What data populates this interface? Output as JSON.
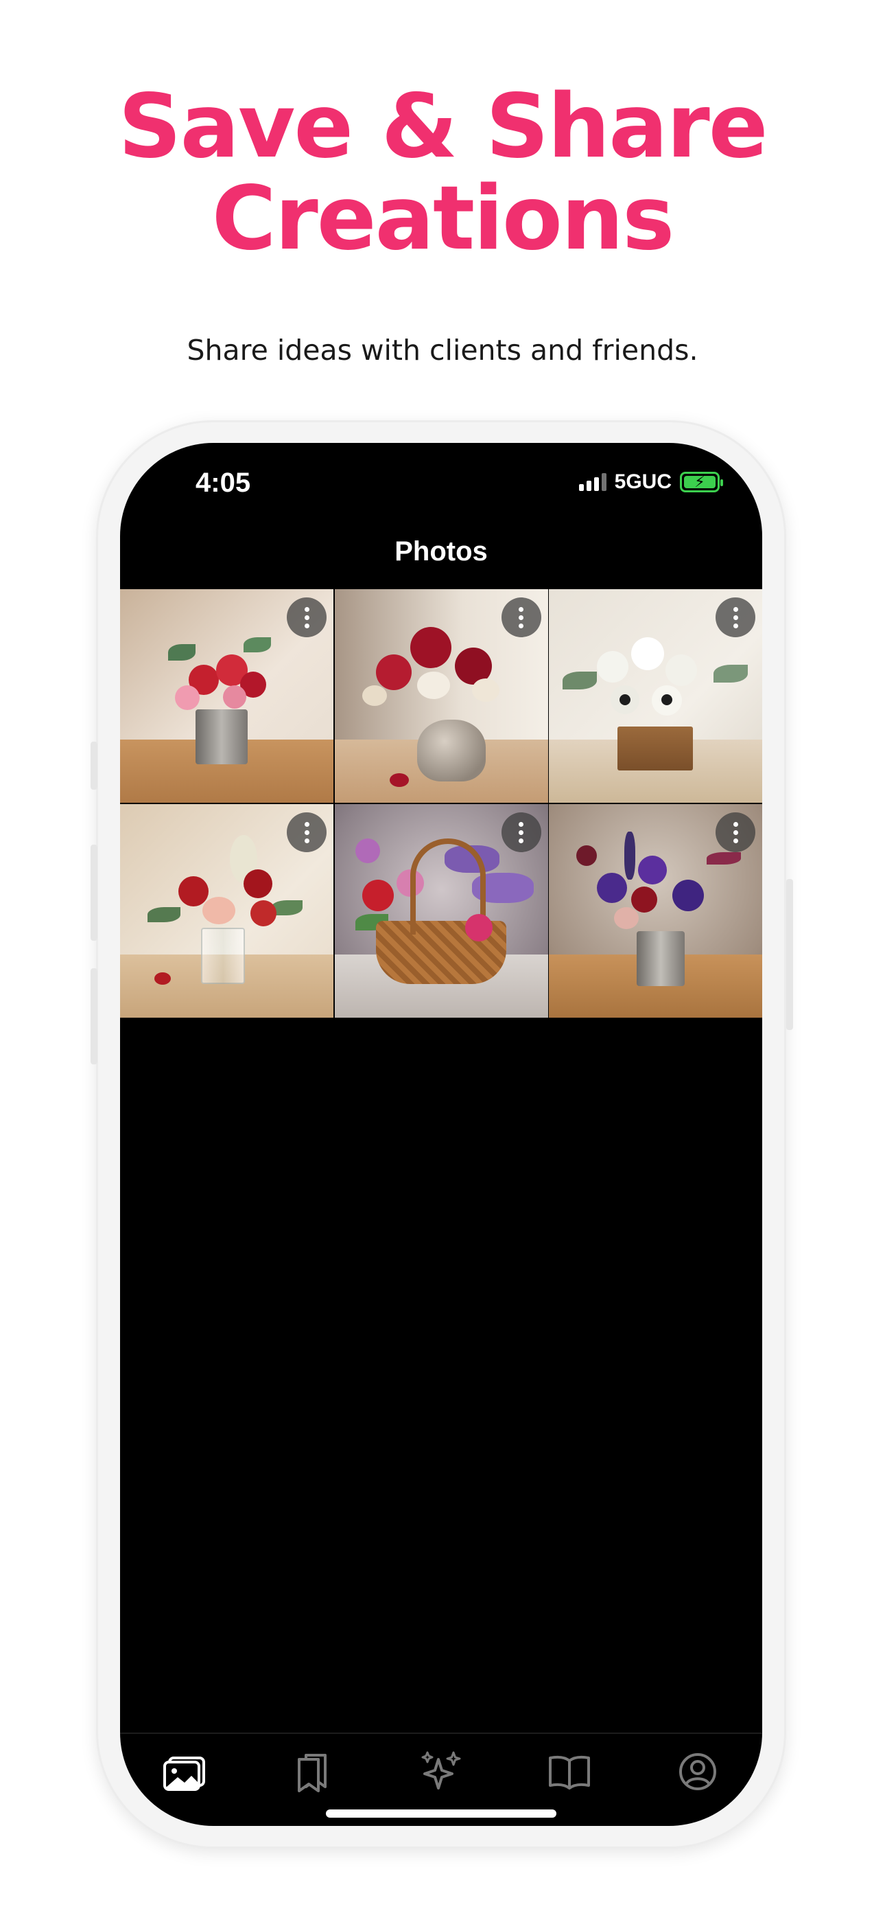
{
  "promo": {
    "headline_line1": "Save & Share",
    "headline_line2": "Creations",
    "subheadline": "Share ideas with clients and friends."
  },
  "colors": {
    "brand_pink": "#f0306f",
    "battery_green": "#3ccf4e",
    "screen_background": "#000000"
  },
  "status_bar": {
    "time": "4:05",
    "network": "5GUC",
    "signal_icon": "signal-bars-icon",
    "battery_icon": "battery-charging-icon"
  },
  "header": {
    "title": "Photos"
  },
  "photos": [
    {
      "subject": "red and pink carnations in metal tin",
      "menu_icon": "more-vertical-icon"
    },
    {
      "subject": "red dahlias and white orchids in ceramic vase",
      "menu_icon": "more-vertical-icon"
    },
    {
      "subject": "white calla lilies in wooden box",
      "menu_icon": "more-vertical-icon"
    },
    {
      "subject": "red roses and white blossoms in glass vase",
      "menu_icon": "more-vertical-icon"
    },
    {
      "subject": "lavender and red flowers in wicker basket",
      "menu_icon": "more-vertical-icon"
    },
    {
      "subject": "purple irises and red flowers in metal tin",
      "menu_icon": "more-vertical-icon"
    }
  ],
  "tabbar": {
    "tabs": [
      {
        "icon": "photos-icon",
        "active": true
      },
      {
        "icon": "bookmarks-icon",
        "active": false
      },
      {
        "icon": "sparkles-icon",
        "active": false
      },
      {
        "icon": "book-icon",
        "active": false
      },
      {
        "icon": "profile-icon",
        "active": false
      }
    ]
  }
}
